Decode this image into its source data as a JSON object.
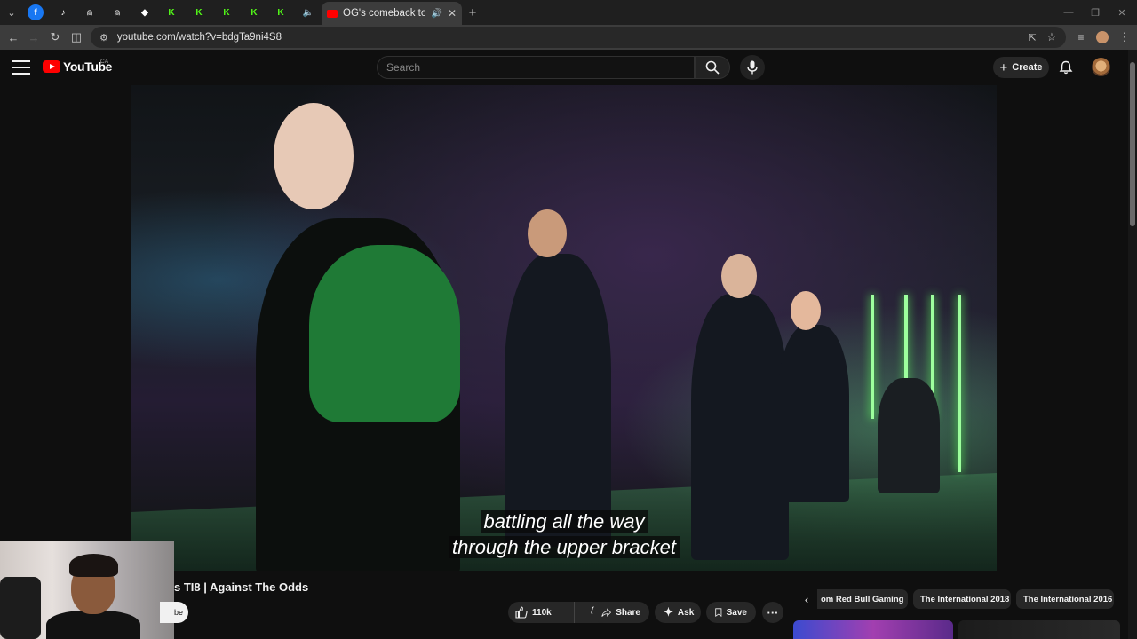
{
  "browser": {
    "tab_title": "OG's comeback to win DOTA",
    "address": "youtube.com/watch?v=bdgTa9ni4S8",
    "pinned_tabs": [
      {
        "icon": "facebook-icon",
        "glyph": "f",
        "color": "#1877f2"
      },
      {
        "icon": "tiktok-icon",
        "glyph": "♪",
        "color": "#ffffff"
      },
      {
        "icon": "game-icon",
        "glyph": "⍝",
        "color": "#c7c7c7"
      },
      {
        "icon": "game-icon",
        "glyph": "⍝",
        "color": "#c7c7c7"
      },
      {
        "icon": "diamond-icon",
        "glyph": "◆",
        "color": "#ffffff"
      },
      {
        "icon": "kick-icon",
        "glyph": "K",
        "color": "#53fc18"
      },
      {
        "icon": "kick-icon",
        "glyph": "K",
        "color": "#53fc18"
      },
      {
        "icon": "kick-icon",
        "glyph": "K",
        "color": "#53fc18"
      },
      {
        "icon": "kick-icon",
        "glyph": "K",
        "color": "#53fc18"
      },
      {
        "icon": "kick-icon",
        "glyph": "K",
        "color": "#53fc18"
      },
      {
        "icon": "speaker-icon",
        "glyph": "🔈",
        "color": "#c7c7c7"
      }
    ]
  },
  "youtube": {
    "logo_text": "YouTube",
    "country_code": "CA",
    "search_placeholder": "Search",
    "create_label": "Create"
  },
  "video": {
    "subtitle_line1": "battling all the way",
    "subtitle_line2": "through the upper bracket",
    "title_visible": "s TI8 | Against The Odds",
    "subscribe_fragment": "be",
    "like_count": "110k",
    "share_label": "Share",
    "ask_label": "Ask",
    "save_label": "Save"
  },
  "chips": [
    "om Red Bull Gaming",
    "The International 2018",
    "The International 2016"
  ],
  "colors": {
    "youtube_red": "#ff0000",
    "kick_green": "#53fc18",
    "background": "#0f0f0f"
  }
}
